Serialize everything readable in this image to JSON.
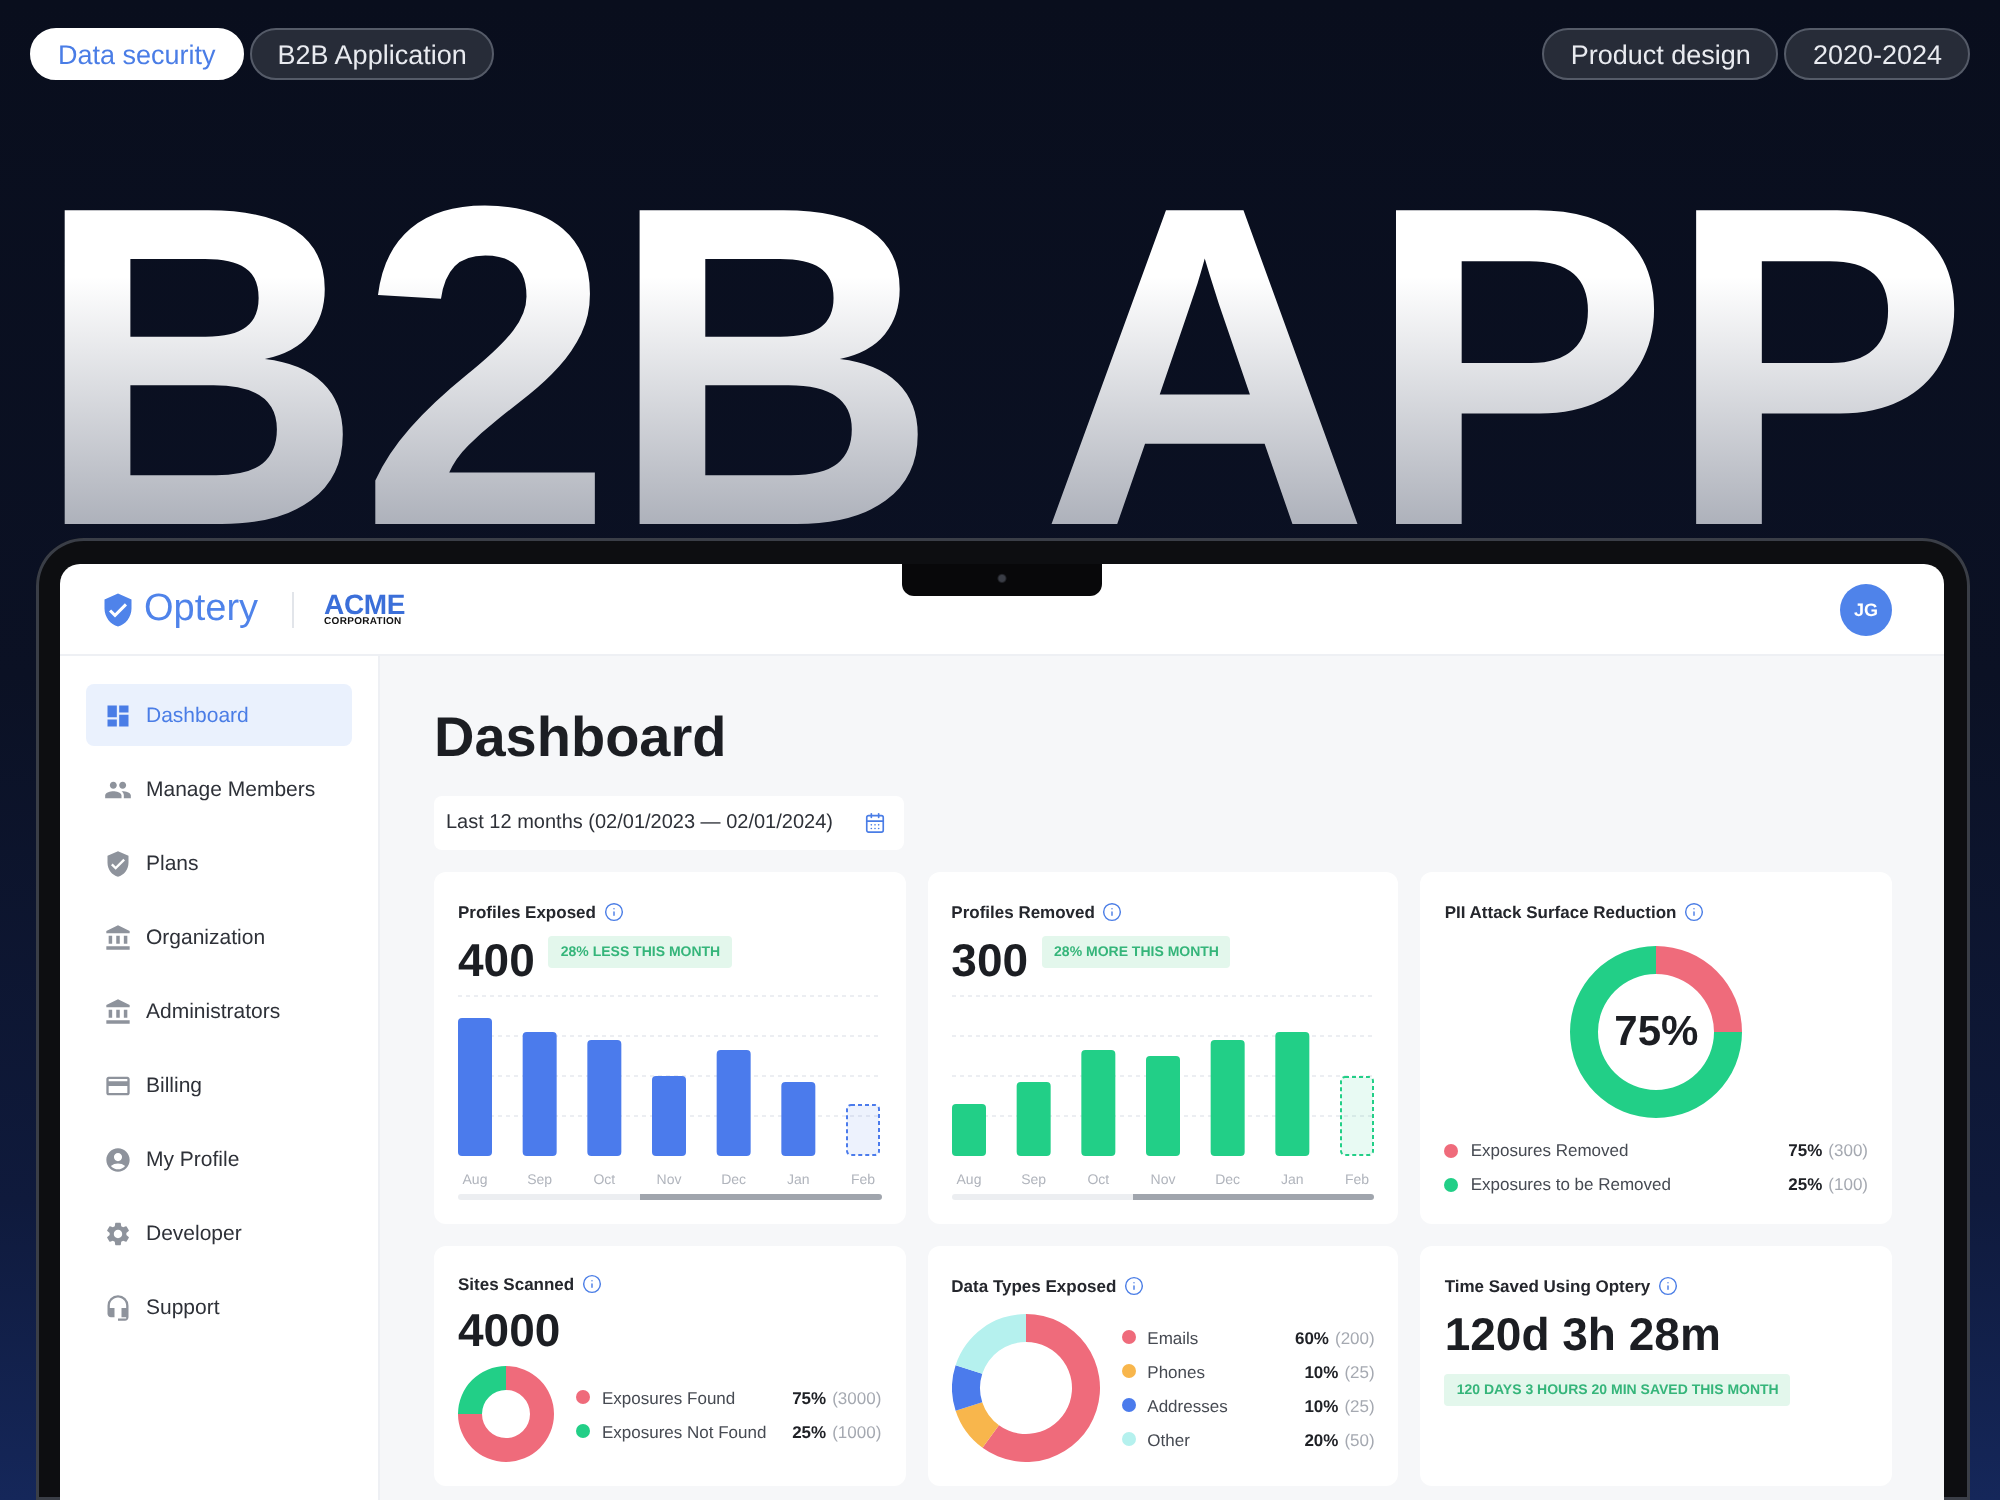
{
  "left_tags": [
    {
      "label": "Data security",
      "selected": true
    },
    {
      "label": "B2B Application",
      "selected": false
    }
  ],
  "right_tags": [
    {
      "label": "Product design",
      "selected": false
    },
    {
      "label": "2020-2024",
      "selected": false
    }
  ],
  "hero_title": "B2B APP",
  "app": {
    "header": {
      "brand": "Optery",
      "client_logo": {
        "name": "ACME",
        "subtitle": "CORPORATION"
      },
      "avatar_initials": "JG"
    },
    "sidebar": {
      "items": [
        {
          "label": "Dashboard",
          "selected": true
        },
        {
          "label": "Manage Members",
          "selected": false
        },
        {
          "label": "Plans",
          "selected": false
        },
        {
          "label": "Organization",
          "selected": false
        },
        {
          "label": "Administrators",
          "selected": false
        },
        {
          "label": "Billing",
          "selected": false
        },
        {
          "label": "My Profile",
          "selected": false
        },
        {
          "label": "Developer",
          "selected": false
        },
        {
          "label": "Support",
          "selected": false
        }
      ]
    },
    "page_title": "Dashboard",
    "date_range": {
      "value": "Last 12 months (02/01/2023 — 02/01/2024)"
    },
    "cards": [
      {
        "kind": "bar_chart",
        "title": "Profiles Exposed",
        "value": "400",
        "trend": "28% LESS THIS MONTH",
        "color": "#4b7bec",
        "months": [
          {
            "label": "Aug",
            "projected": false
          },
          {
            "label": "Sep",
            "projected": false
          },
          {
            "label": "Oct",
            "projected": false
          },
          {
            "label": "Nov",
            "projected": false
          },
          {
            "label": "Dec",
            "projected": false
          },
          {
            "label": "Jan",
            "projected": false
          },
          {
            "label": "Feb",
            "projected": true
          }
        ]
      },
      {
        "kind": "bar_chart",
        "title": "Profiles Removed",
        "value": "300",
        "trend": "28% MORE THIS MONTH",
        "color": "#22cf87",
        "months": [
          {
            "label": "Aug",
            "projected": false
          },
          {
            "label": "Sep",
            "projected": false
          },
          {
            "label": "Oct",
            "projected": false
          },
          {
            "label": "Nov",
            "projected": false
          },
          {
            "label": "Dec",
            "projected": false
          },
          {
            "label": "Jan",
            "projected": false
          },
          {
            "label": "Feb",
            "projected": true
          }
        ]
      },
      {
        "kind": "ring_chart",
        "title": "PII Attack Surface Reduction",
        "center_label": "75%",
        "chart_data": {
          "type": "donut",
          "categories": [
            "Exposures Removed",
            "Exposures to be Removed"
          ],
          "values": [
            25,
            75
          ]
        },
        "legend": [
          {
            "share": "75%",
            "count": "(300)",
            "color": "#ef6b7b"
          },
          {
            "share": "25%",
            "count": "(100)",
            "color": "#22cf87"
          }
        ]
      },
      {
        "kind": "ring_with_value",
        "title": "Sites Scanned",
        "value": "4000",
        "chart_data": {
          "type": "donut",
          "categories": [
            "Exposures Found",
            "Exposures Not Found"
          ],
          "values": [
            75,
            25
          ]
        },
        "legend": [
          {
            "share": "75%",
            "count": "(3000)",
            "color": "#ef6b7b"
          },
          {
            "share": "25%",
            "count": "(1000)",
            "color": "#22cf87"
          }
        ]
      },
      {
        "kind": "ring_side",
        "title": "Data Types Exposed",
        "chart_data": {
          "type": "donut",
          "categories": [
            "Emails",
            "Phones",
            "Addresses",
            "Other"
          ],
          "values": [
            60,
            10,
            10,
            20
          ]
        },
        "legend": [
          {
            "share": "60%",
            "count": "(200)",
            "color": "#ef6b7b"
          },
          {
            "share": "10%",
            "count": "(25)",
            "color": "#f8b64c"
          },
          {
            "share": "10%",
            "count": "(25)",
            "color": "#4b7bec"
          },
          {
            "share": "20%",
            "count": "(50)",
            "color": "#b5f1ee"
          }
        ]
      },
      {
        "kind": "stat",
        "title": "Time Saved Using Optery",
        "value": "120d 3h 28m",
        "trend": "120 DAYS 3 HOURS 20 MIN SAVED THIS MONTH"
      }
    ]
  }
}
